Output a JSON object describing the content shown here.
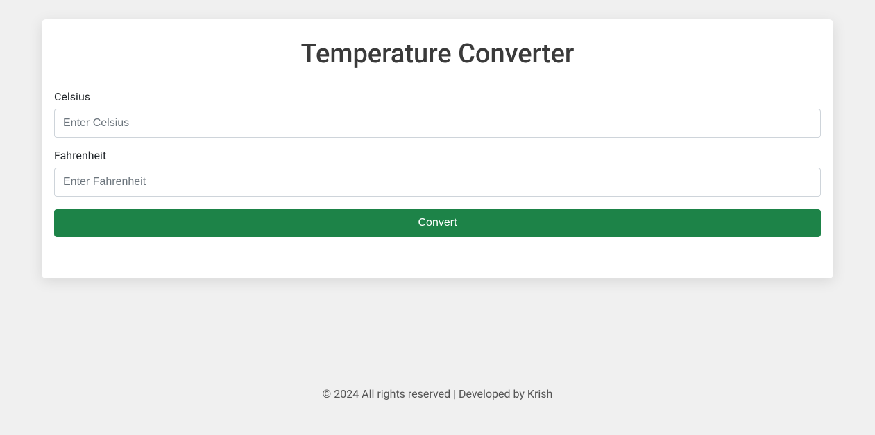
{
  "header": {
    "title": "Temperature Converter"
  },
  "form": {
    "celsius": {
      "label": "Celsius",
      "placeholder": "Enter Celsius",
      "value": ""
    },
    "fahrenheit": {
      "label": "Fahrenheit",
      "placeholder": "Enter Fahrenheit",
      "value": ""
    },
    "convert_button_label": "Convert"
  },
  "footer": {
    "text": "© 2024 All rights reserved | Developed by Krish"
  }
}
